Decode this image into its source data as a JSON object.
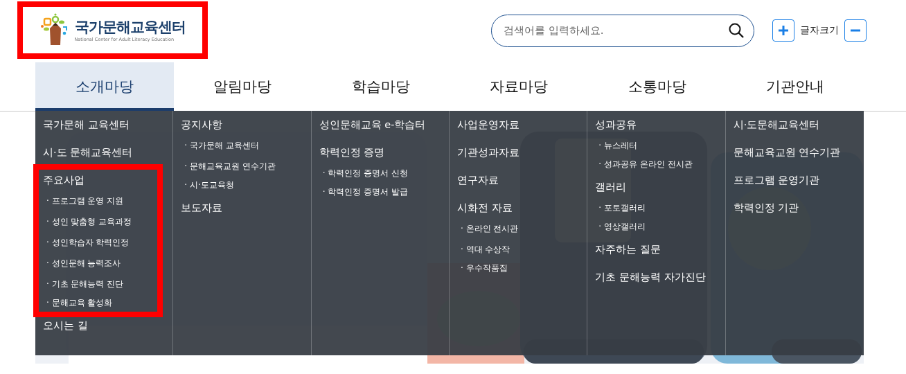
{
  "logo": {
    "title": "국가문해교육센터",
    "subtitle": "National Center for Adult Literacy Education",
    "highlighted": true
  },
  "search": {
    "placeholder": "검색어를 입력하세요."
  },
  "font_size": {
    "label": "글자크기"
  },
  "nav": [
    {
      "label": "소개마당",
      "selected": true
    },
    {
      "label": "알림마당",
      "selected": false
    },
    {
      "label": "학습마당",
      "selected": false
    },
    {
      "label": "자료마당",
      "selected": false
    },
    {
      "label": "소통마당",
      "selected": false
    },
    {
      "label": "기관안내",
      "selected": false
    }
  ],
  "menu_columns": [
    {
      "items": [
        {
          "label": "국가문해 교육센터",
          "highlighted": false
        },
        {
          "label": "시·도 문해교육센터",
          "highlighted": false
        },
        {
          "label": "주요사업",
          "highlighted": true,
          "children": [
            "· 프로그램 운영 지원",
            "· 성인 맞춤형 교육과정",
            "· 성인학습자 학력인정",
            "· 성인문해 능력조사",
            "· 기초 문해능력 진단",
            "· 문해교육 활성화"
          ]
        },
        {
          "label": "오시는 길",
          "highlighted": false
        }
      ]
    },
    {
      "items": [
        {
          "label": "공지사항",
          "highlighted": false,
          "children": [
            "· 국가문해 교육센터",
            "· 문해교육교원 연수기관",
            "· 시·도교육청"
          ]
        },
        {
          "label": "보도자료",
          "highlighted": false
        }
      ]
    },
    {
      "items": [
        {
          "label": "성인문해교육 e-학습터",
          "highlighted": false
        },
        {
          "label": "학력인정 증명",
          "highlighted": false,
          "children": [
            "· 학력인정 증명서 신청",
            "· 학력인정 증명서 발급"
          ]
        }
      ]
    },
    {
      "items": [
        {
          "label": "사업운영자료",
          "highlighted": false
        },
        {
          "label": "기관성과자료",
          "highlighted": false
        },
        {
          "label": "연구자료",
          "highlighted": false
        },
        {
          "label": "시화전 자료",
          "highlighted": false,
          "children": [
            "· 온라인 전시관",
            "· 역대 수상작",
            "· 우수작품집"
          ]
        }
      ]
    },
    {
      "items": [
        {
          "label": "성과공유",
          "highlighted": false,
          "children": [
            "· 뉴스레터",
            "· 성과공유 온라인 전시관"
          ]
        },
        {
          "label": "갤러리",
          "highlighted": false,
          "children": [
            "· 포토갤러리",
            "· 영상갤러리"
          ]
        },
        {
          "label": "자주하는 질문",
          "highlighted": false
        },
        {
          "label": "기초 문해능력 자가진단",
          "highlighted": false
        }
      ]
    },
    {
      "items": [
        {
          "label": "시·도문해교육센터",
          "highlighted": false
        },
        {
          "label": "문해교육교원 연수기관",
          "highlighted": false
        },
        {
          "label": "프로그램 운영기관",
          "highlighted": false
        },
        {
          "label": "학력인정 기관",
          "highlighted": false
        }
      ]
    }
  ]
}
